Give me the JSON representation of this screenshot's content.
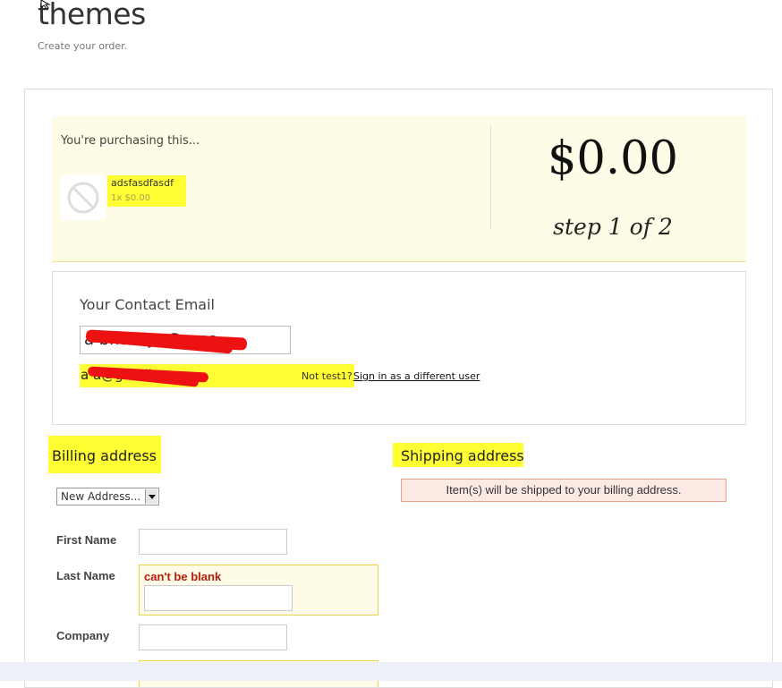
{
  "header": {
    "title": "themes",
    "subtitle": "Create your order."
  },
  "summary": {
    "purchasing_label": "You're purchasing this...",
    "item_name": "adsfasdfasdf",
    "item_qty": "1x $0.00",
    "total": "$0.00",
    "step": "step 1 of 2"
  },
  "contact": {
    "heading": "Your Contact Email",
    "email_input_value": "a                 bhartiya@gma",
    "email_display": "a                    a@gmail.com",
    "not_you": "Not test1?",
    "switch_link": "Sign in as a different user"
  },
  "billing": {
    "heading": "Billing address",
    "address_select": "New Address...",
    "first_name_label": "First Name",
    "last_name_label": "Last Name",
    "last_name_error": "can't be blank",
    "company_label": "Company"
  },
  "shipping": {
    "heading": "Shipping address",
    "note": "Item(s) will be shipped to your billing address."
  },
  "colors": {
    "highlight": "#ffff33",
    "panel_bg": "#fefbe6",
    "error_text": "#b81a0a",
    "redaction": "#ee1111"
  }
}
